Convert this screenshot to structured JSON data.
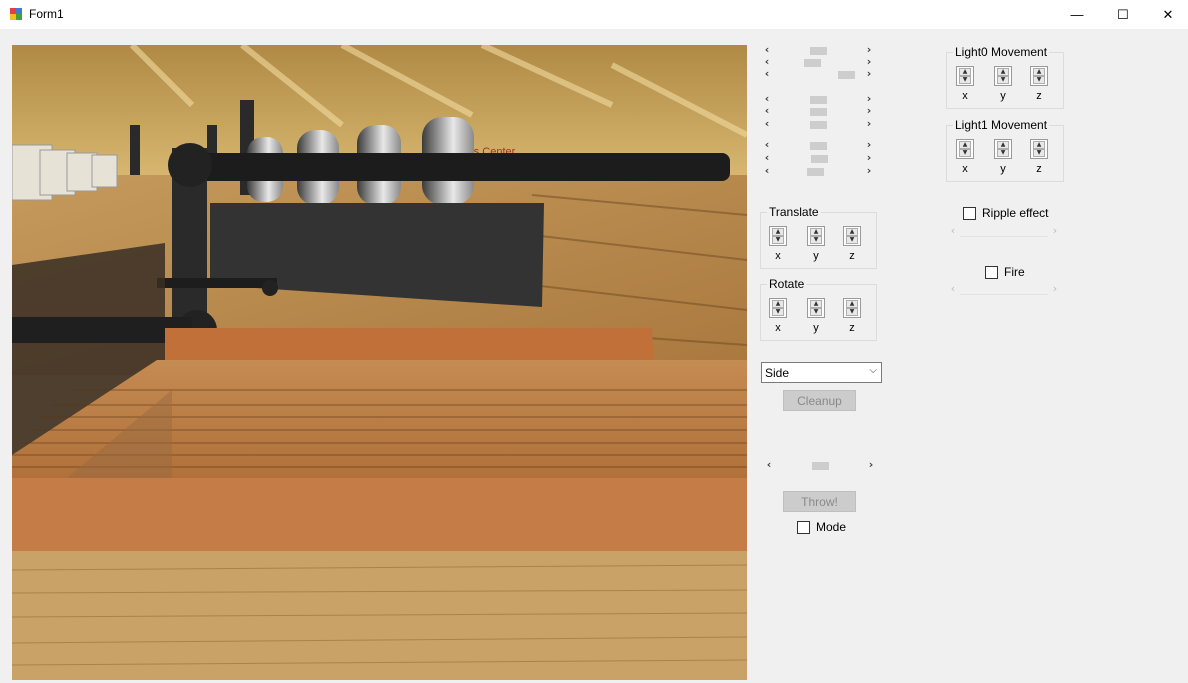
{
  "window": {
    "title": "Form1",
    "minimize_glyph": "—",
    "maximize_glyph": "☐",
    "close_glyph": "✕"
  },
  "icons": {
    "app": "form-app-icon",
    "scroll_left": "‹",
    "scroll_right": "›",
    "spin_up": "▲",
    "spin_down": "▼",
    "combo_chevron": "⌵"
  },
  "scrollbars": {
    "group1": [
      0.5,
      0.42,
      0.9
    ],
    "group2": [
      0.5,
      0.5,
      0.5
    ],
    "group3": [
      0.5,
      0.52,
      0.47
    ],
    "throw_power": 0.5
  },
  "translate": {
    "title": "Translate",
    "x": "x",
    "y": "y",
    "z": "z"
  },
  "rotate": {
    "title": "Rotate",
    "x": "x",
    "y": "y",
    "z": "z"
  },
  "view_select": {
    "value": "Side"
  },
  "cleanup_button": "Cleanup",
  "throw_button": "Throw!",
  "mode_checkbox": {
    "label": "Mode",
    "checked": false
  },
  "light0": {
    "title": "Light0 Movement",
    "x": "x",
    "y": "y",
    "z": "z"
  },
  "light1": {
    "title": "Light1 Movement",
    "x": "x",
    "y": "y",
    "z": "z"
  },
  "ripple_checkbox": {
    "label": "Ripple effect",
    "checked": false
  },
  "fire_checkbox": {
    "label": "Fire",
    "checked": false
  },
  "viewport": {
    "sign_text": "rts Center"
  }
}
